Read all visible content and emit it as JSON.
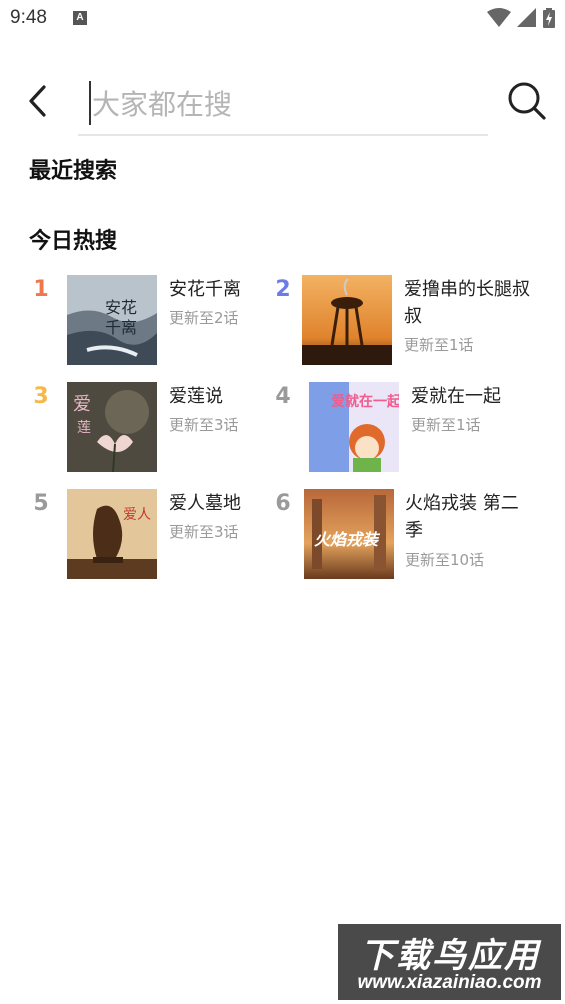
{
  "status_bar": {
    "time": "9:48",
    "app_icon_letter": "A"
  },
  "search": {
    "placeholder": "大家都在搜",
    "value": ""
  },
  "sections": {
    "recent_title": "最近搜索",
    "hot_title": "今日热搜"
  },
  "hot_items": [
    {
      "rank": "1",
      "rank_color": "#f0764e",
      "title": "安花千离",
      "subtitle": "更新至2话"
    },
    {
      "rank": "2",
      "rank_color": "#6c7bea",
      "title": "爱撸串的长腿叔叔",
      "subtitle": "更新至1话"
    },
    {
      "rank": "3",
      "rank_color": "#f5b94a",
      "title": "爱莲说",
      "subtitle": "更新至3话"
    },
    {
      "rank": "4",
      "rank_color": "#9a9a9a",
      "title": "爱就在一起",
      "subtitle": "更新至1话"
    },
    {
      "rank": "5",
      "rank_color": "#9a9a9a",
      "title": "爱人墓地",
      "subtitle": "更新至3话"
    },
    {
      "rank": "6",
      "rank_color": "#9a9a9a",
      "title": "火焰戎装 第二季",
      "subtitle": "更新至10话"
    }
  ],
  "watermark": {
    "line1": "下载鸟应用",
    "line2": "www.xiazainiao.com"
  }
}
